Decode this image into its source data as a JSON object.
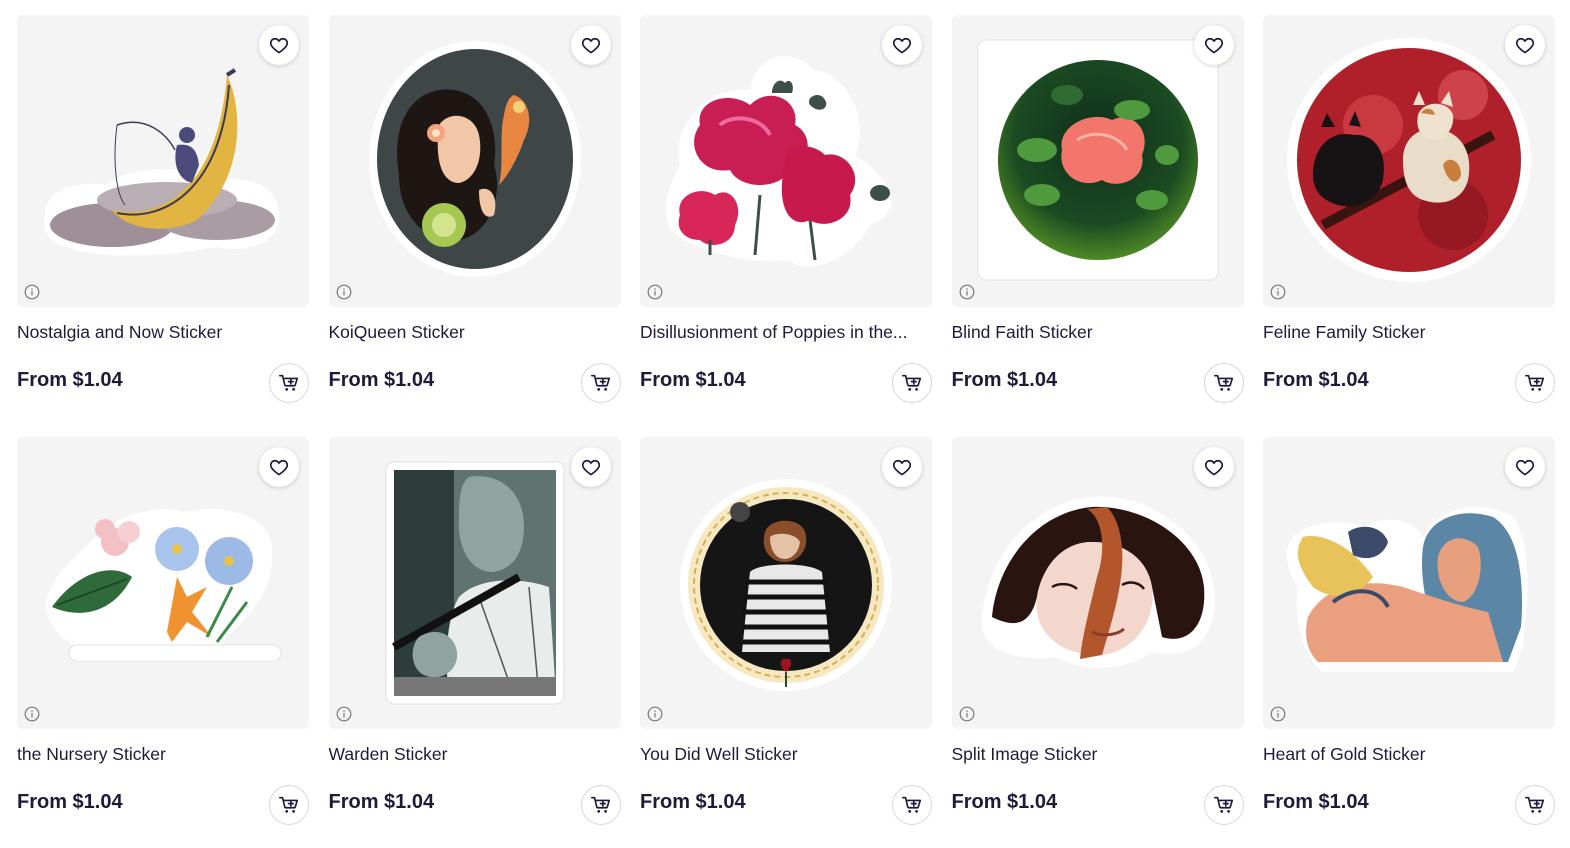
{
  "products": [
    {
      "title": "Nostalgia and Now Sticker",
      "price": "From $1.04",
      "image": "banana-boat-sticker"
    },
    {
      "title": "KoiQueen Sticker",
      "price": "From $1.04",
      "image": "koi-queen-sticker"
    },
    {
      "title": "Disillusionment of Poppies in the...",
      "price": "From $1.04",
      "image": "poppies-sticker"
    },
    {
      "title": "Blind Faith Sticker",
      "price": "From $1.04",
      "image": "blind-faith-sticker"
    },
    {
      "title": "Feline Family Sticker",
      "price": "From $1.04",
      "image": "feline-family-sticker"
    },
    {
      "title": "the Nursery Sticker",
      "price": "From $1.04",
      "image": "nursery-flowers-sticker"
    },
    {
      "title": "Warden Sticker",
      "price": "From $1.04",
      "image": "warden-sticker"
    },
    {
      "title": "You Did Well Sticker",
      "price": "From $1.04",
      "image": "you-did-well-sticker"
    },
    {
      "title": "Split Image Sticker",
      "price": "From $1.04",
      "image": "split-image-sticker"
    },
    {
      "title": "Heart of Gold Sticker",
      "price": "From $1.04",
      "image": "heart-of-gold-sticker"
    }
  ],
  "icons": {
    "favorite": "heart-icon",
    "info": "info-icon",
    "cart": "add-to-cart-icon"
  },
  "colors": {
    "text": "#1d1a3a",
    "thumb_bg": "#f4f4f4"
  }
}
